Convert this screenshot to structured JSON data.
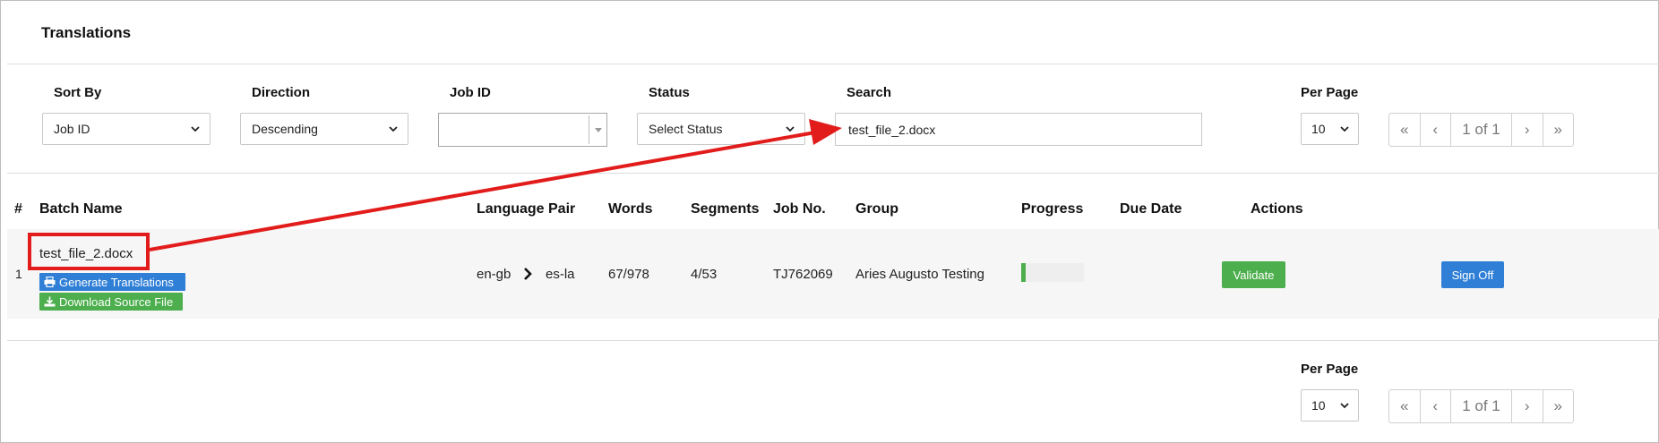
{
  "page": {
    "title": "Translations"
  },
  "filters": {
    "sort_by": {
      "label": "Sort By",
      "value": "Job ID"
    },
    "direction": {
      "label": "Direction",
      "value": "Descending"
    },
    "job_id": {
      "label": "Job ID",
      "value": ""
    },
    "status": {
      "label": "Status",
      "value": "Select Status"
    },
    "search": {
      "label": "Search",
      "value": "test_file_2.docx"
    },
    "per_page": {
      "label": "Per Page",
      "value": "10"
    }
  },
  "pagination": {
    "first": "«",
    "prev": "‹",
    "current": "1 of 1",
    "next": "›",
    "last": "»"
  },
  "table": {
    "headers": [
      "#",
      "Batch Name",
      "Language Pair",
      "Words",
      "Segments",
      "Job No.",
      "Group",
      "Progress",
      "Due Date",
      "Actions"
    ],
    "rows": [
      {
        "num": "1",
        "batch_name": "test_file_2.docx",
        "generate_label": "Generate Translations",
        "download_label": "Download Source File",
        "source_lang": "en-gb",
        "target_lang": "es-la",
        "words": "67/978",
        "segments": "4/53",
        "job_no": "TJ762069",
        "group": "Aries Augusto Testing",
        "progress": 0.07,
        "due_date": "",
        "validate_label": "Validate",
        "signoff_label": "Sign Off"
      }
    ]
  },
  "footer": {
    "per_page_label": "Per Page",
    "per_page_value": "10"
  },
  "colors": {
    "blue": "#2f7fd6",
    "green": "#4cae4c",
    "annotation_red": "#e21b1b"
  }
}
